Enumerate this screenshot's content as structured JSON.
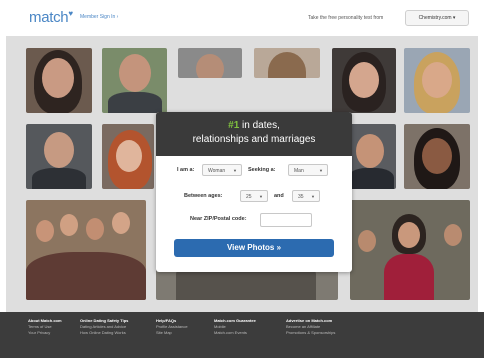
{
  "header": {
    "logo": "match",
    "logo_mark": "♥",
    "member_sign_in": "Member Sign In ›",
    "promo_text": "Take the free personality test from",
    "chemistry_button": "Chemistry.com ▾"
  },
  "search_card": {
    "headline_number": "#1",
    "headline_rest": " in dates,",
    "headline_line2": "relationships and marriages",
    "i_am_label": "I am a:",
    "i_am_value": "Woman",
    "seeking_label": "Seeking a:",
    "seeking_value": "Man",
    "between_ages_label": "Between ages:",
    "age_from": "25",
    "and_label": "and",
    "age_to": "35",
    "zip_label": "Near ZIP/Postal code:",
    "zip_value": "",
    "view_photos_button": "View Photos »",
    "caret": "▼"
  },
  "footer": {
    "columns": [
      {
        "heading": "About Match.com",
        "links": [
          "Terms of Use",
          "Your Privacy"
        ]
      },
      {
        "heading": "Online Dating Safety Tips",
        "links": [
          "Dating Articles and Advice",
          "How Online Dating Works"
        ]
      },
      {
        "heading": "Help/FAQs",
        "links": [
          "Profile Assistance",
          "Site Map"
        ]
      },
      {
        "heading": "Match.com Guarantee",
        "links": [
          "Mobile",
          "Match.com Events"
        ]
      },
      {
        "heading": "Advertise on Match.com",
        "links": [
          "Become an Affiliate",
          "Promotions & Sponsorships"
        ]
      }
    ]
  },
  "colors": {
    "brand_blue": "#4a86c5",
    "button_blue": "#2c6bb0",
    "headline_green": "#7fbf3f",
    "card_header": "#3a3a3a",
    "footer_bg": "#3c3c3c"
  }
}
